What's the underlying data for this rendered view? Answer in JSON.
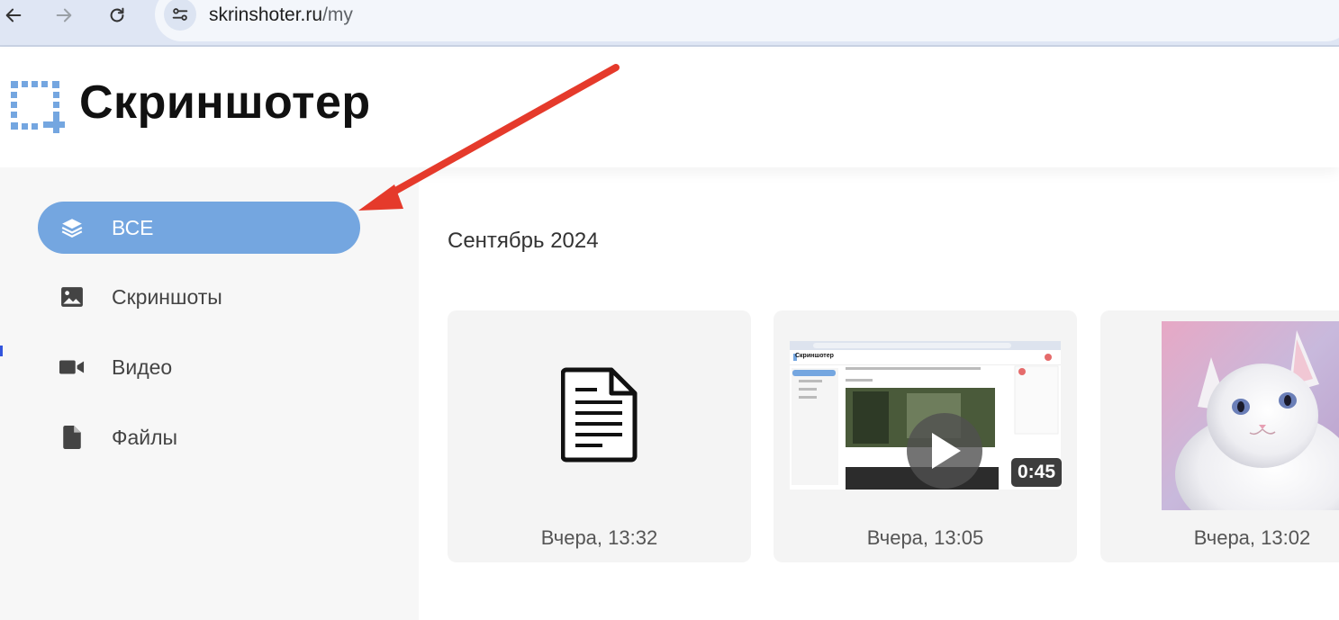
{
  "browser": {
    "url_host": "skrinshoter.ru",
    "url_path": "/my",
    "back_icon": "arrow-left-icon",
    "forward_icon": "arrow-right-icon",
    "reload_icon": "reload-icon",
    "site_info_icon": "tune-icon"
  },
  "header": {
    "logo_text": "Скриншотер",
    "logo_icon": "screenshot-selection-icon",
    "accent": "#74a6e0"
  },
  "sidebar": {
    "items": [
      {
        "label": "ВСЕ",
        "icon": "layers-icon",
        "active": true
      },
      {
        "label": "Скриншоты",
        "icon": "image-icon",
        "active": false
      },
      {
        "label": "Видео",
        "icon": "video-camera-icon",
        "active": false
      },
      {
        "label": "Файлы",
        "icon": "file-icon",
        "active": false
      }
    ]
  },
  "main": {
    "month_title": "Сентябрь 2024",
    "cards": [
      {
        "type": "file",
        "icon": "document-icon",
        "time": "Вчера, 13:32"
      },
      {
        "type": "video",
        "duration": "0:45",
        "time": "Вчера, 13:05",
        "thumb_logo": "Скриншотер"
      },
      {
        "type": "screenshot",
        "thumb": "white-kitten-image",
        "time": "Вчера, 13:02"
      }
    ]
  },
  "annotation": {
    "arrow_color": "#e53a2b"
  }
}
